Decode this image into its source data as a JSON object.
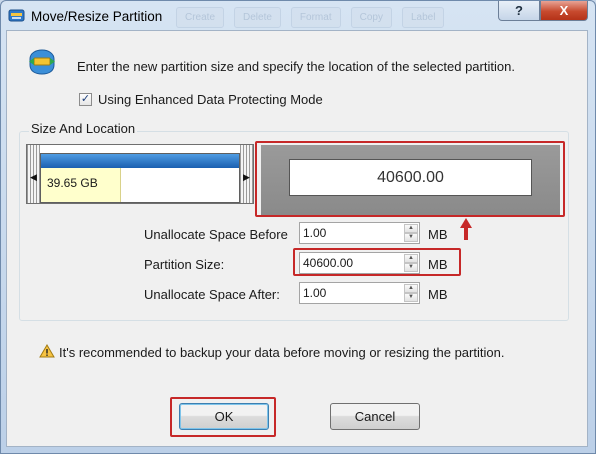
{
  "window": {
    "title": "Move/Resize Partition",
    "help_label": "?",
    "close_label": "X"
  },
  "ghost_toolbar": [
    "Create",
    "Delete",
    "Format",
    "Copy",
    "Label"
  ],
  "instruction": "Enter the new partition size and specify the location of the selected partition.",
  "checkbox": {
    "label": "Using Enhanced Data Protecting Mode",
    "checked": true,
    "mark": "✓"
  },
  "section": {
    "title": "Size And Location"
  },
  "disk_map": {
    "partition_size_label": "39.65 GB",
    "left_handle": "◀",
    "right_handle": "▶"
  },
  "zoom": {
    "value": "40600.00"
  },
  "fields": {
    "before": {
      "label": "Unallocate Space Before",
      "value": "1.00",
      "unit": "MB"
    },
    "size": {
      "label": "Partition Size:",
      "value": "40600.00",
      "unit": "MB"
    },
    "after": {
      "label": "Unallocate Space After:",
      "value": "1.00",
      "unit": "MB"
    }
  },
  "spin": {
    "up": "▲",
    "down": "▼"
  },
  "warning": "It's recommended to backup your data before moving or resizing the partition.",
  "buttons": {
    "ok": "OK",
    "cancel": "Cancel"
  },
  "colors": {
    "highlight": "#c62828",
    "partition_bar": "#1a5fb0",
    "used_space": "#ffffcc"
  }
}
